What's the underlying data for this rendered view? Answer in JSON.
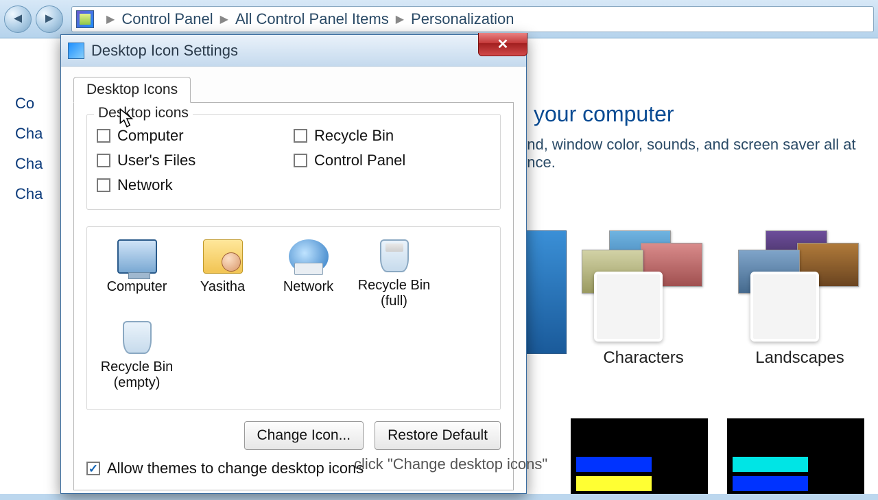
{
  "breadcrumb": {
    "parts": [
      "Control Panel",
      "All Control Panel Items",
      "Personalization"
    ]
  },
  "sidebar_stubs": [
    "Co",
    "Cha",
    "Cha",
    "Cha"
  ],
  "background": {
    "heading_fragment": "your computer",
    "sub_fragment": "und, window color, sounds, and screen saver all at once.",
    "themes": {
      "characters": "Characters",
      "landscapes": "Landscapes"
    }
  },
  "dialog": {
    "title": "Desktop Icon Settings",
    "tab": "Desktop Icons",
    "group_legend": "Desktop icons",
    "checks": {
      "computer": "Computer",
      "users_files": "User's Files",
      "network": "Network",
      "recycle_bin": "Recycle Bin",
      "control_panel": "Control Panel"
    },
    "icons": {
      "computer": "Computer",
      "user_folder": "Yasitha",
      "network": "Network",
      "recycle_full_l1": "Recycle Bin",
      "recycle_full_l2": "(full)",
      "recycle_empty_l1": "Recycle Bin",
      "recycle_empty_l2": "(empty)"
    },
    "buttons": {
      "change_icon": "Change Icon...",
      "restore_default": "Restore Default"
    },
    "allow_label": "Allow themes to change desktop icons"
  },
  "caption": "click \"Change desktop icons\""
}
